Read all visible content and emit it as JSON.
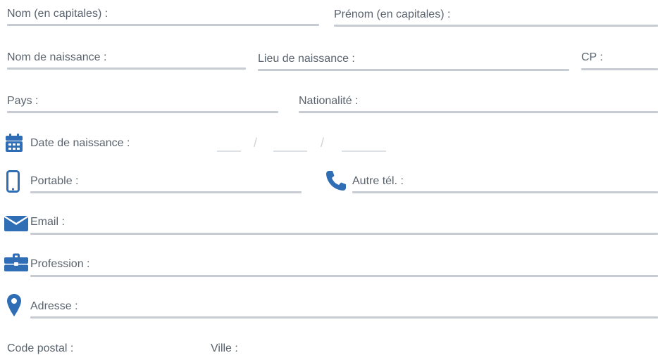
{
  "colors": {
    "icon": "#2f6eb5",
    "line": "#c6ccd2",
    "label": "#5a636d"
  },
  "form": {
    "nom_label": "Nom (en capitales) :",
    "prenom_label": "Prénom (en capitales) :",
    "nom_naissance_label": "Nom de naissance :",
    "lieu_naissance_label": "Lieu de naissance :",
    "cp_label": "CP :",
    "pays_label": "Pays :",
    "nationalite_label": "Nationalité :",
    "date_naissance_label": "Date de naissance :",
    "date_separator": "/",
    "portable_label": "Portable :",
    "autre_tel_label": "Autre tél. :",
    "email_label": "Email :",
    "profession_label": "Profession :",
    "adresse_label": "Adresse :",
    "code_postal_label": "Code postal :",
    "ville_label": "Ville :"
  },
  "icons": {
    "calendar": "calendar-icon",
    "mobile": "mobile-phone-icon",
    "phone": "phone-handset-icon",
    "email": "envelope-icon",
    "profession": "briefcase-icon",
    "address": "map-pin-icon"
  }
}
